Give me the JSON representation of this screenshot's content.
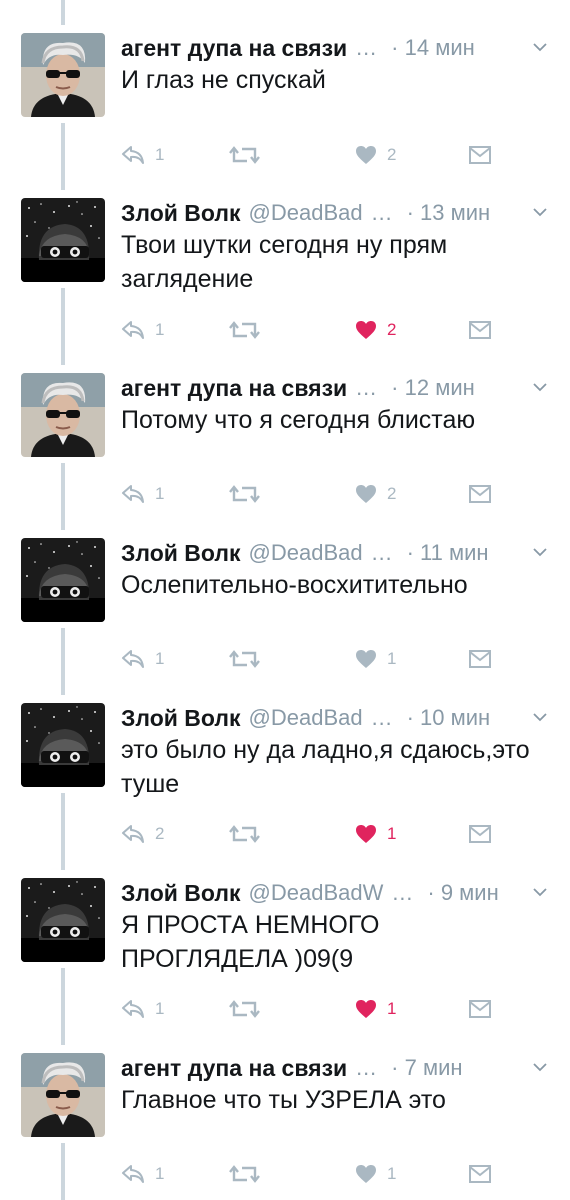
{
  "tweets": [
    {
      "name": "агент дупа на связи",
      "handle": "",
      "time": "14 мин",
      "text": "И глаз не спускай",
      "reply": "1",
      "retweet": "",
      "like": "2",
      "liked": false,
      "author": "lynch"
    },
    {
      "name": "Злой Волк",
      "handle": "@DeadBad",
      "time": "13 мин",
      "text": "Твои шутки сегодня ну прям заглядение",
      "reply": "1",
      "retweet": "",
      "like": "2",
      "liked": true,
      "author": "wolf"
    },
    {
      "name": "агент дупа на связи",
      "handle": "",
      "time": "12 мин",
      "text": "Потому что я сегодня блистаю",
      "reply": "1",
      "retweet": "",
      "like": "2",
      "liked": false,
      "author": "lynch"
    },
    {
      "name": "Злой Волк",
      "handle": "@DeadBad",
      "time": "11 мин",
      "text": "Ослепительно-восхитительно",
      "reply": "1",
      "retweet": "",
      "like": "1",
      "liked": false,
      "author": "wolf"
    },
    {
      "name": "Злой Волк",
      "handle": "@DeadBad",
      "time": "10 мин",
      "text": "это было ну да ладно,я сдаюсь,это туше",
      "reply": "2",
      "retweet": "",
      "like": "1",
      "liked": true,
      "author": "wolf"
    },
    {
      "name": "Злой Волк",
      "handle": "@DeadBadW",
      "time": "9 мин",
      "text": "Я ПРОСТА НЕМНОГО ПРОГЛЯДЕЛА )09(9",
      "reply": "1",
      "retweet": "",
      "like": "1",
      "liked": true,
      "author": "wolf"
    },
    {
      "name": "агент дупа на связи",
      "handle": "",
      "time": "7 мин",
      "text": "Главное что ты УЗРЕЛА это",
      "reply": "1",
      "retweet": "",
      "like": "1",
      "liked": false,
      "author": "lynch"
    }
  ],
  "icons": {
    "reply": "reply-icon",
    "retweet": "retweet-icon",
    "like": "heart-icon",
    "dm": "direct-message-icon",
    "menu": "chevron-down-icon"
  },
  "colors": {
    "like_active": "#e0245e",
    "muted": "#aab8c2",
    "line": "#ccd6dd"
  }
}
